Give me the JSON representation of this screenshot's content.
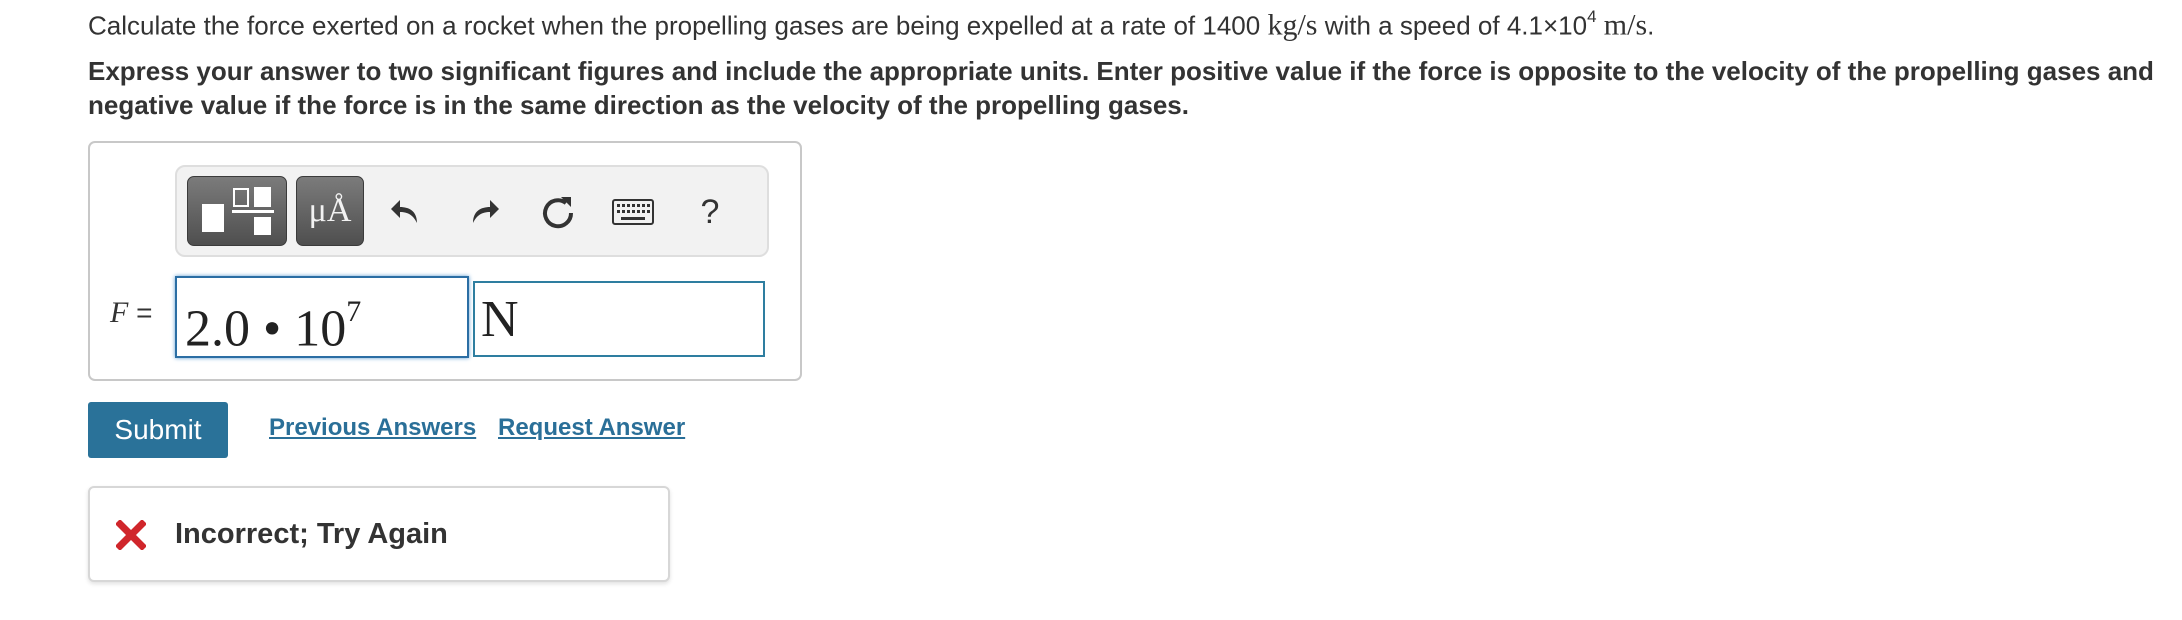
{
  "question": {
    "text_before": "Calculate the force exerted on a rocket when the propelling gases are being expelled at a rate of 1400",
    "rate_unit": "kg/s",
    "text_middle": "with a speed of 4.1×10",
    "speed_exponent": "4",
    "speed_unit": "m/s",
    "text_end": "."
  },
  "instructions": {
    "line1": "Express your answer to two significant figures and include the appropriate units. Enter positive value if the force is opposite to the velocity of the propelling gases and",
    "line2": "negative value if the force is in the same direction as the velocity of the propelling gases."
  },
  "toolbar": {
    "icons": [
      "templates-icon",
      "units-icon",
      "undo-icon",
      "redo-icon",
      "reset-icon",
      "keyboard-icon",
      "help-icon"
    ],
    "units_label": "μÅ",
    "help_label": "?"
  },
  "answer": {
    "variable": "F",
    "equals": "=",
    "value_mantissa": "2.0 • 10",
    "value_exponent": "7",
    "units": "N"
  },
  "actions": {
    "submit_label": "Submit",
    "previous_answers_label": "Previous Answers",
    "request_answer_label": "Request Answer"
  },
  "feedback": {
    "icon": "x-icon",
    "color": "#d0262b",
    "message": "Incorrect; Try Again"
  }
}
